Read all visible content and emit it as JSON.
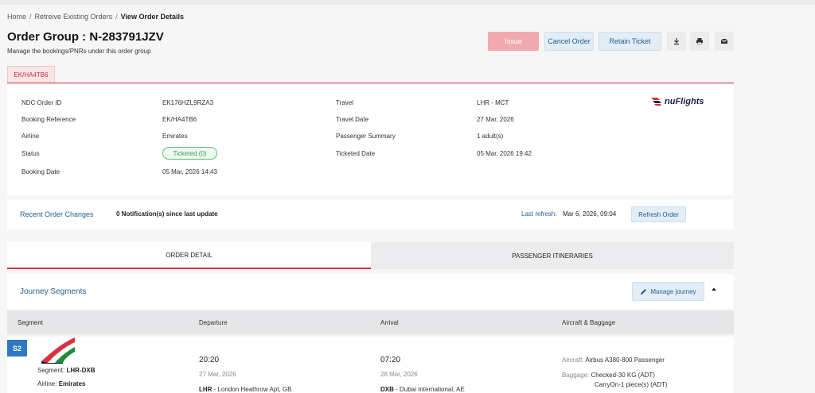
{
  "breadcrumb": {
    "home": "Home",
    "orders": "Retreive Existing Orders",
    "current": "View Order Details",
    "sep": "/"
  },
  "header": {
    "title": "Order Group : N-283791JZV",
    "subtitle": "Manage the bookings/PNRs under this order group"
  },
  "actions": {
    "issue": "Issue",
    "cancel": "Cancel Order",
    "retain": "Retain Ticket"
  },
  "icons": {
    "download": "download-icon",
    "print": "print-icon",
    "email": "email-icon",
    "pencil": "pencil-icon",
    "collapse": "chevron-up-icon"
  },
  "pnr_tab": "EK/HA4TB6",
  "details": {
    "ndc_label": "NDC Order ID",
    "ndc_value": "EK176HZL9RZA3",
    "booking_ref_label": "Booking Reference",
    "booking_ref_value": "EK/HA4TB6",
    "airline_label": "Airline",
    "airline_value": "Emirates",
    "status_label": "Status",
    "status_value": "Ticketed (0)",
    "booking_date_label": "Booking Date",
    "booking_date_value": "05 Mar, 2026 14:43",
    "travel_label": "Travel",
    "travel_value": "LHR - MCT",
    "travel_date_label": "Travel Date",
    "travel_date_value": "27 Mar, 2026",
    "pax_label": "Passenger Summary",
    "pax_value": "1 adult(s)",
    "ticketed_date_label": "Ticketed Date",
    "ticketed_date_value": "05 Mar, 2026 19:42"
  },
  "logo": {
    "text": "nuFlights"
  },
  "changes": {
    "title": "Recent Order Changes",
    "notifications": "0 Notification(s) since last update",
    "refresh_label": "Last refresh:",
    "refresh_value": "Mar 6, 2026, 09:04",
    "refresh_button": "Refresh Order"
  },
  "tabs": {
    "order_detail": "ORDER DETAIL",
    "itineraries": "PASSENGER ITINERARIES"
  },
  "journey": {
    "title": "Journey Segments",
    "manage": "Manage journey"
  },
  "segment_table": {
    "headers": {
      "segment": "Segment",
      "departure": "Departure",
      "arrival": "Arrival",
      "aircraft": "Aircraft & Baggage"
    }
  },
  "segment": {
    "badge": "S2",
    "segment_label": "Segment:",
    "segment_value": "LHR-DXB",
    "airline_label": "Airline:",
    "airline_value": "Emirates",
    "dep_time": "20:20",
    "dep_date": "27 Mar, 2026",
    "dep_code": "LHR",
    "dep_place": " - London Heathrow Apt, GB",
    "arr_time": "07:20",
    "arr_date": "28 Mar, 2026",
    "arr_code": "DXB",
    "arr_place": " - Dubai International, AE",
    "aircraft_label": "Aircraft:",
    "aircraft_value": "Airbus A380-800 Passenger",
    "baggage_label": "Baggage:",
    "baggage_checked": "Checked-30 KG (ADT)",
    "baggage_carryon": "CarryOn-1 piece(s) (ADT)"
  },
  "colors": {
    "accent": "#1f5f93",
    "brand_red": "#d9323f",
    "ticketed_green": "#3a9d56",
    "issue_disabled": "#f2a9ae"
  }
}
